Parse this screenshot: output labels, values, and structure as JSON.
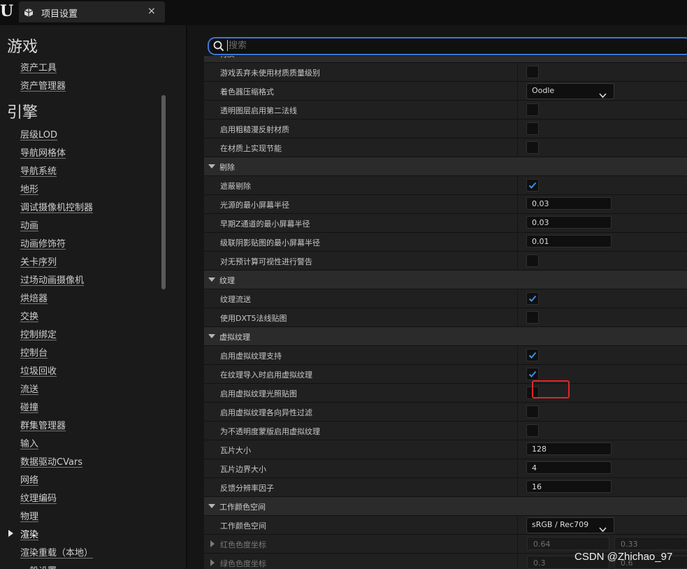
{
  "tab": {
    "title": "项目设置",
    "close": "×"
  },
  "sidebar": {
    "game_header": "游戏",
    "game_items": [
      "资产工具",
      "资产管理器"
    ],
    "engine_header": "引擎",
    "engine_items": [
      "层级LOD",
      "导航网格体",
      "导航系统",
      "地形",
      "调试摄像机控制器",
      "动画",
      "动画修饰符",
      "关卡序列",
      "过场动画摄像机",
      "烘焙器",
      "交换",
      "控制绑定",
      "控制台",
      "垃圾回收",
      "流送",
      "碰撞",
      "群集管理器",
      "输入",
      "数据驱动CVars",
      "网络",
      "纹理编码",
      "物理",
      "渲染",
      "渲染重载（本地）",
      "一般设置"
    ],
    "active_item": "渲染"
  },
  "search": {
    "placeholder": "搜索"
  },
  "rows": [
    {
      "type": "section",
      "label": "材质"
    },
    {
      "type": "prop",
      "label": "游戏丢弃未使用材质质量级别",
      "control": "checkbox",
      "checked": false
    },
    {
      "type": "prop",
      "label": "着色器压缩格式",
      "control": "dropdown",
      "value": "Oodle"
    },
    {
      "type": "prop",
      "label": "透明图层启用第二法线",
      "control": "checkbox",
      "checked": false
    },
    {
      "type": "prop",
      "label": "启用粗糙漫反射材质",
      "control": "checkbox",
      "checked": false
    },
    {
      "type": "prop",
      "label": "在材质上实现节能",
      "control": "checkbox",
      "checked": false
    },
    {
      "type": "section",
      "label": "剔除"
    },
    {
      "type": "prop",
      "label": "遮蔽剔除",
      "control": "checkbox",
      "checked": true
    },
    {
      "type": "prop",
      "label": "光源的最小屏幕半径",
      "control": "number",
      "value": "0.03"
    },
    {
      "type": "prop",
      "label": "早期Z通道的最小屏幕半径",
      "control": "number",
      "value": "0.03"
    },
    {
      "type": "prop",
      "label": "级联阴影贴图的最小屏幕半径",
      "control": "number",
      "value": "0.01"
    },
    {
      "type": "prop",
      "label": "对无预计算可视性进行警告",
      "control": "checkbox",
      "checked": false
    },
    {
      "type": "section",
      "label": "纹理"
    },
    {
      "type": "prop",
      "label": "纹理流送",
      "control": "checkbox",
      "checked": true
    },
    {
      "type": "prop",
      "label": "使用DXT5法线贴图",
      "control": "checkbox",
      "checked": false
    },
    {
      "type": "section",
      "label": "虚拟纹理"
    },
    {
      "type": "prop",
      "label": "启用虚拟纹理支持",
      "control": "checkbox",
      "checked": true
    },
    {
      "type": "prop",
      "label": "在纹理导入时启用虚拟纹理",
      "control": "checkbox",
      "checked": true
    },
    {
      "type": "prop",
      "label": "启用虚拟纹理光照贴图",
      "control": "checkbox",
      "checked": false
    },
    {
      "type": "prop",
      "label": "启用虚拟纹理各向异性过滤",
      "control": "checkbox",
      "checked": false
    },
    {
      "type": "prop",
      "label": "为不透明度蒙版启用虚拟纹理",
      "control": "checkbox",
      "checked": false
    },
    {
      "type": "prop",
      "label": "瓦片大小",
      "control": "number",
      "value": "128"
    },
    {
      "type": "prop",
      "label": "瓦片边界大小",
      "control": "number",
      "value": "4"
    },
    {
      "type": "prop",
      "label": "反馈分辨率因子",
      "control": "number",
      "value": "16"
    },
    {
      "type": "section",
      "label": "工作颜色空间"
    },
    {
      "type": "prop",
      "label": "工作颜色空间",
      "control": "dropdown",
      "value": "sRGB / Rec709"
    },
    {
      "type": "prop",
      "label": "红色色度坐标",
      "control": "pair",
      "values": [
        "0.64",
        "0.33"
      ],
      "dim": true,
      "expandable": true
    },
    {
      "type": "prop",
      "label": "绿色色度坐标",
      "control": "pair",
      "values": [
        "0.3",
        "0.6"
      ],
      "dim": true,
      "expandable": true
    }
  ],
  "watermark": "CSDN @Zhichao_97",
  "colors": {
    "accent": "#3b78d8",
    "highlight": "#e0262b",
    "panel": "#202020",
    "section": "#2b2b2b"
  }
}
